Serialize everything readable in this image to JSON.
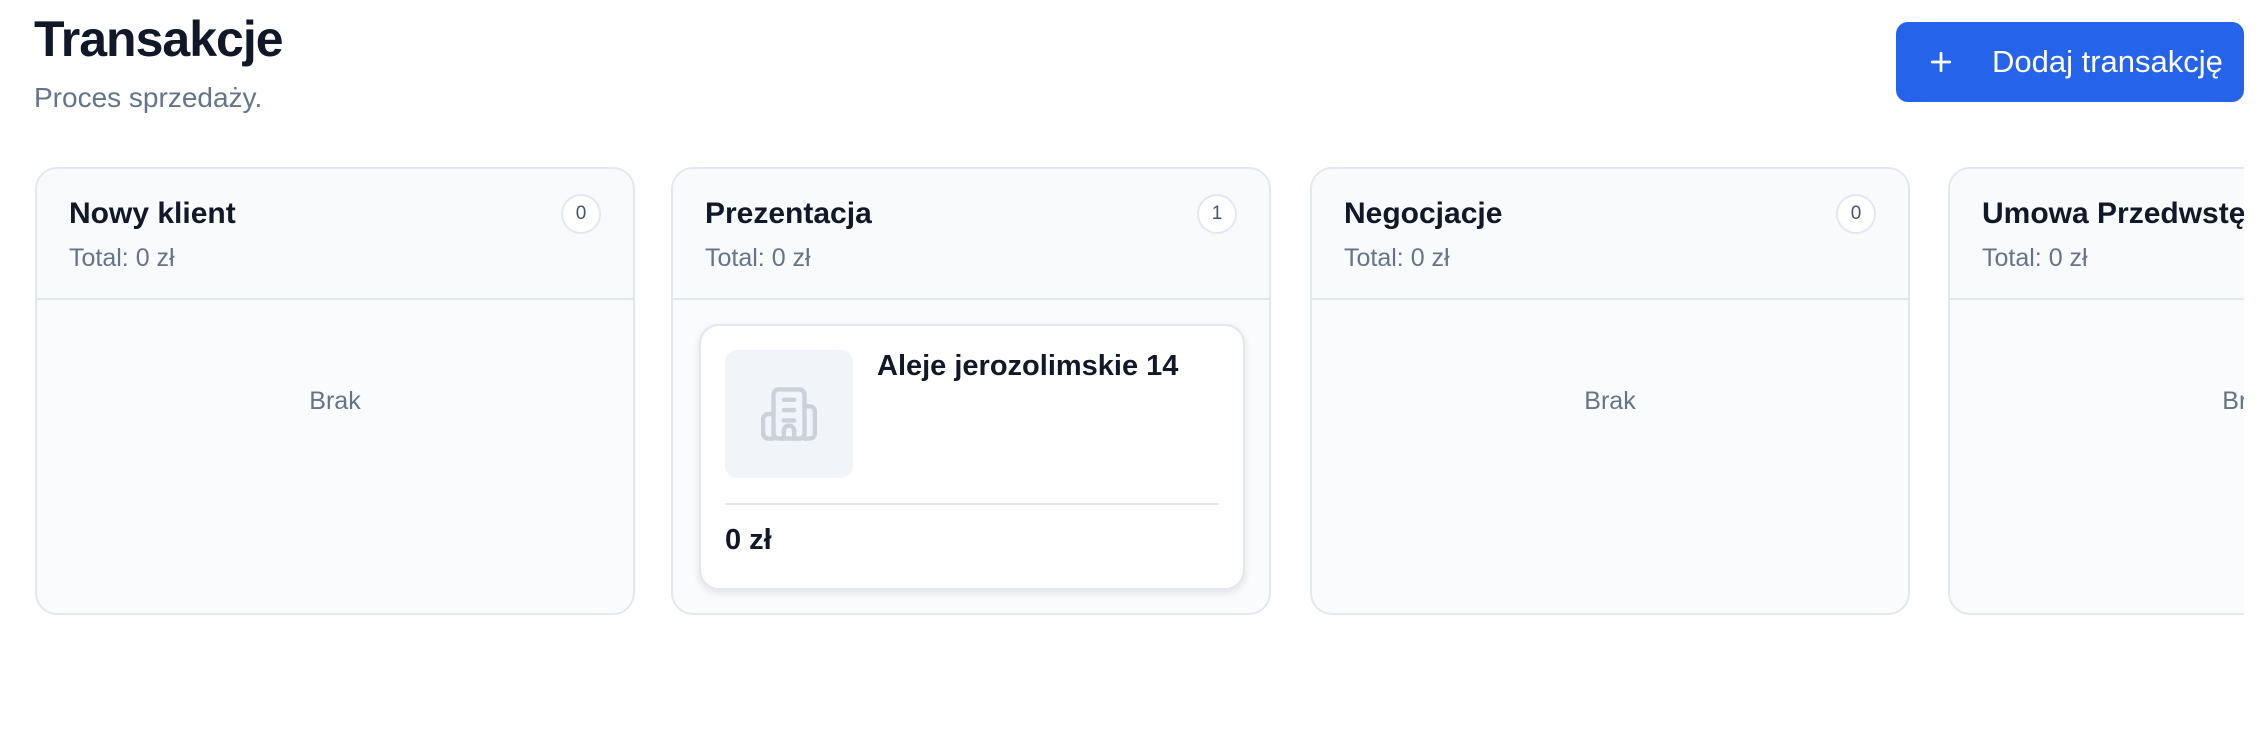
{
  "header": {
    "title": "Transakcje",
    "subtitle": "Proces sprzedaży.",
    "add_button_label": "Dodaj transakcję"
  },
  "colors": {
    "accent": "#2563eb",
    "text_primary": "#111827",
    "text_muted": "#64748b",
    "border": "#e2e8f0"
  },
  "pipeline": {
    "columns": [
      {
        "name": "Nowy klient",
        "total": "Total: 0 zł",
        "count": "0",
        "empty_label": "Brak"
      },
      {
        "name": "Prezentacja",
        "total": "Total: 0 zł",
        "count": "1",
        "cards": [
          {
            "title": "Aleje jerozolimskie 14",
            "amount": "0 zł",
            "icon": "building-icon"
          }
        ]
      },
      {
        "name": "Negocjacje",
        "total": "Total: 0 zł",
        "count": "0",
        "empty_label": "Brak"
      },
      {
        "name": "Umowa Przedwstępna",
        "total": "Total: 0 zł",
        "empty_label": "Brak"
      }
    ]
  }
}
